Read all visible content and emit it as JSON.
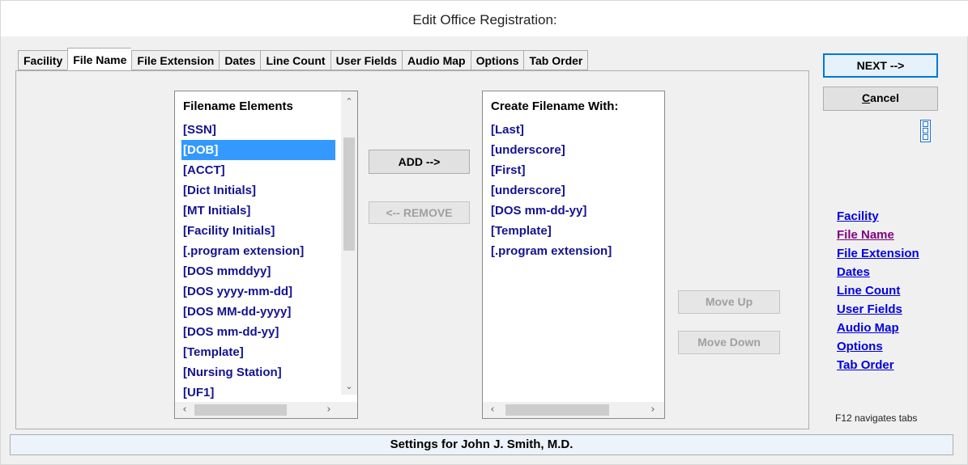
{
  "window": {
    "title": "Edit Office Registration:"
  },
  "tabs": [
    {
      "label": "Facility",
      "active": false
    },
    {
      "label": "File Name",
      "active": true
    },
    {
      "label": "File Extension",
      "active": false
    },
    {
      "label": "Dates",
      "active": false
    },
    {
      "label": "Line Count",
      "active": false
    },
    {
      "label": "User Fields",
      "active": false
    },
    {
      "label": "Audio Map",
      "active": false
    },
    {
      "label": "Options",
      "active": false
    },
    {
      "label": "Tab Order",
      "active": false
    }
  ],
  "filename_elements": {
    "header": "Filename Elements",
    "items": [
      "[SSN]",
      "[DOB]",
      "[ACCT]",
      "[Dict Initials]",
      "[MT Initials]",
      "[Facility Initials]",
      "[.program extension]",
      "[DOS mmddyy]",
      "[DOS yyyy-mm-dd]",
      "[DOS MM-dd-yyyy]",
      "[DOS mm-dd-yy]",
      "[Template]",
      "[Nursing Station]",
      "[UF1]"
    ],
    "selected": "[DOB]"
  },
  "create_filename": {
    "header": "Create Filename With:",
    "items": [
      "[Last]",
      "[underscore]",
      "[First]",
      "[underscore]",
      "[DOS mm-dd-yy]",
      "[Template]",
      "[.program extension]"
    ]
  },
  "buttons": {
    "add": "ADD -->",
    "remove": "<-- REMOVE",
    "move_up": "Move Up",
    "move_down": "Move Down",
    "next": "NEXT -->",
    "cancel_accel": "C",
    "cancel_rest": "ancel"
  },
  "nav_links": [
    "Facility",
    "File Name",
    "File Extension",
    "Dates",
    "Line Count",
    "User Fields",
    "Audio Map",
    "Options",
    "Tab Order"
  ],
  "hint": "F12 navigates tabs",
  "status": "Settings for John J. Smith, M.D.",
  "colors": {
    "list_text": "#131390",
    "selection": "#3399ff",
    "link": "#0000e0",
    "visited_link": "#800080"
  }
}
